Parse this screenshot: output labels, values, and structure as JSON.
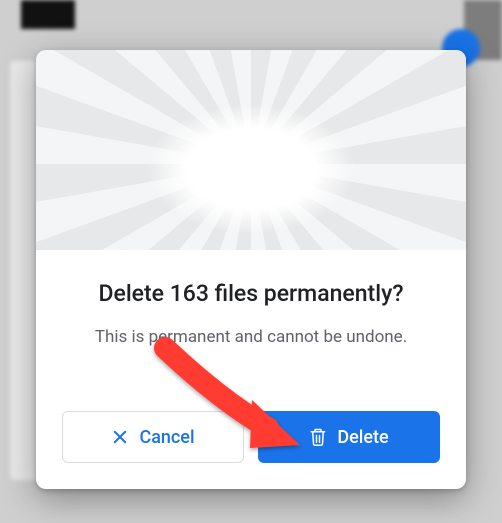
{
  "dialog": {
    "title": "Delete 163 files permanently?",
    "subtitle": "This is permanent and cannot be undone.",
    "cancel_label": "Cancel",
    "delete_label": "Delete"
  },
  "colors": {
    "primary": "#1a73e8",
    "text": "#202124",
    "text_secondary": "#5f6368",
    "border": "#dadce0"
  }
}
